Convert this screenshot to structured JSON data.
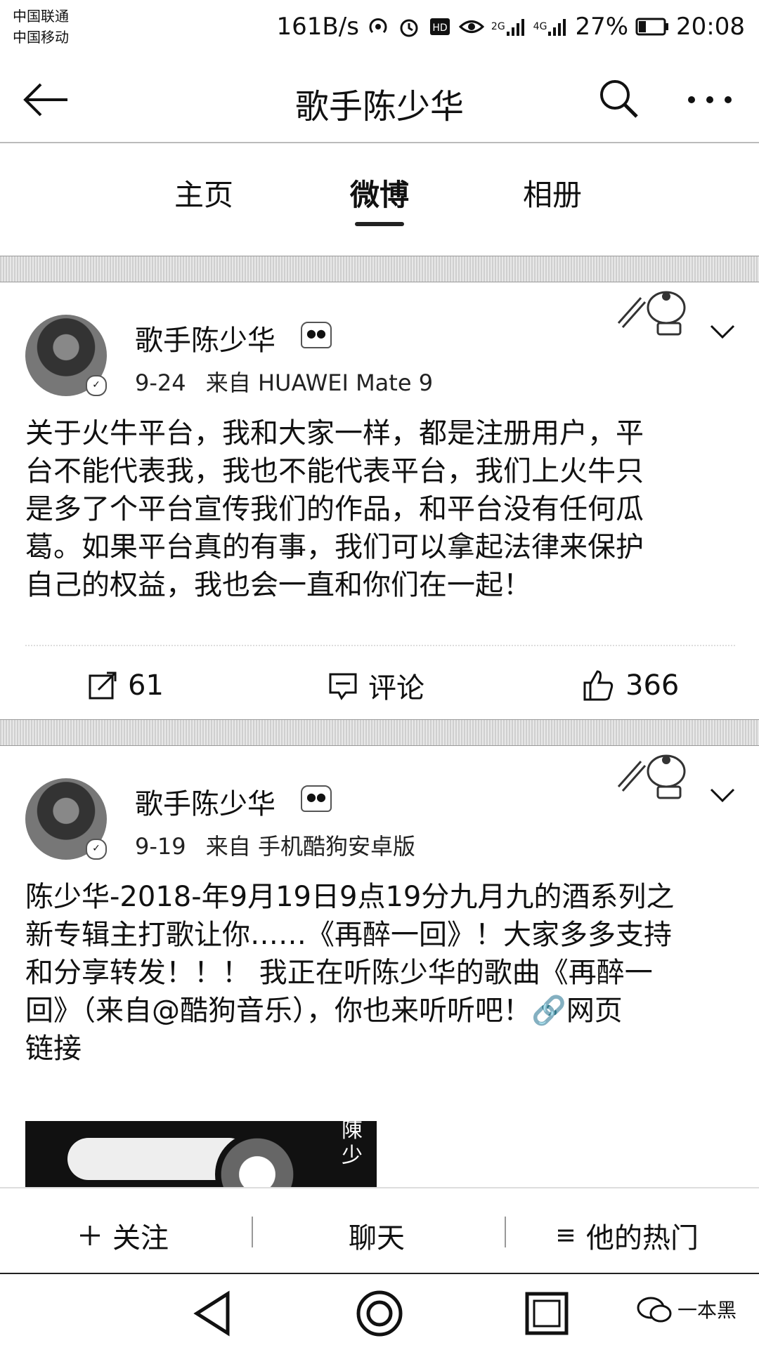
{
  "status_bar": {
    "carrier1": "中国联通",
    "carrier2": "中国移动",
    "network_speed": "161B/s",
    "sig1_label": "2G",
    "sig2_label": "4G",
    "battery": "27%",
    "time": "20:08",
    "icons": [
      "hotspot-icon",
      "alarm-icon",
      "hd-icon",
      "eye-icon",
      "signal-icon",
      "battery-icon"
    ]
  },
  "header": {
    "title": "歌手陈少华",
    "icons": [
      "back-arrow-icon",
      "search-icon",
      "more-icon"
    ]
  },
  "tabs": [
    {
      "label": "主页",
      "active": false
    },
    {
      "label": "微博",
      "active": true
    },
    {
      "label": "相册",
      "active": false
    }
  ],
  "posts": [
    {
      "username": "歌手陈少华",
      "date": "9-24",
      "source": "来自 HUAWEI Mate 9",
      "text_lines": [
        "关于火牛平台，我和大家一样，都是注册用户，平",
        "台不能代表我，我也不能代表平台，我们上火牛只",
        "是多了个平台宣传我们的作品，和平台没有任何瓜",
        "葛。如果平台真的有事，我们可以拿起法律来保护",
        "自己的权益，我也会一直和你们在一起！"
      ],
      "reposts": "61",
      "comments_label": "评论",
      "likes": "366"
    },
    {
      "username": "歌手陈少华",
      "date": "9-19",
      "source": "来自 手机酷狗安卓版",
      "text_lines": [
        "陈少华-2018-年9月19日9点19分九月九的酒系列之",
        "新专辑主打歌让你……《再醉一回》！大家多多支持",
        "和分享转发！！！ 我正在听陈少华的歌曲《再醉一",
        "回》（来自@酷狗音乐），你也来听听吧！",
        "链接"
      ],
      "link_label": "网页",
      "thumb_text": "陳少"
    }
  ],
  "bottom_bar": {
    "follow": "关注",
    "chat": "聊天",
    "hot": "他的热门"
  },
  "nav_bar": {
    "watermark": "一本黑",
    "icons": [
      "nav-back-icon",
      "nav-home-icon",
      "nav-recents-icon"
    ]
  }
}
